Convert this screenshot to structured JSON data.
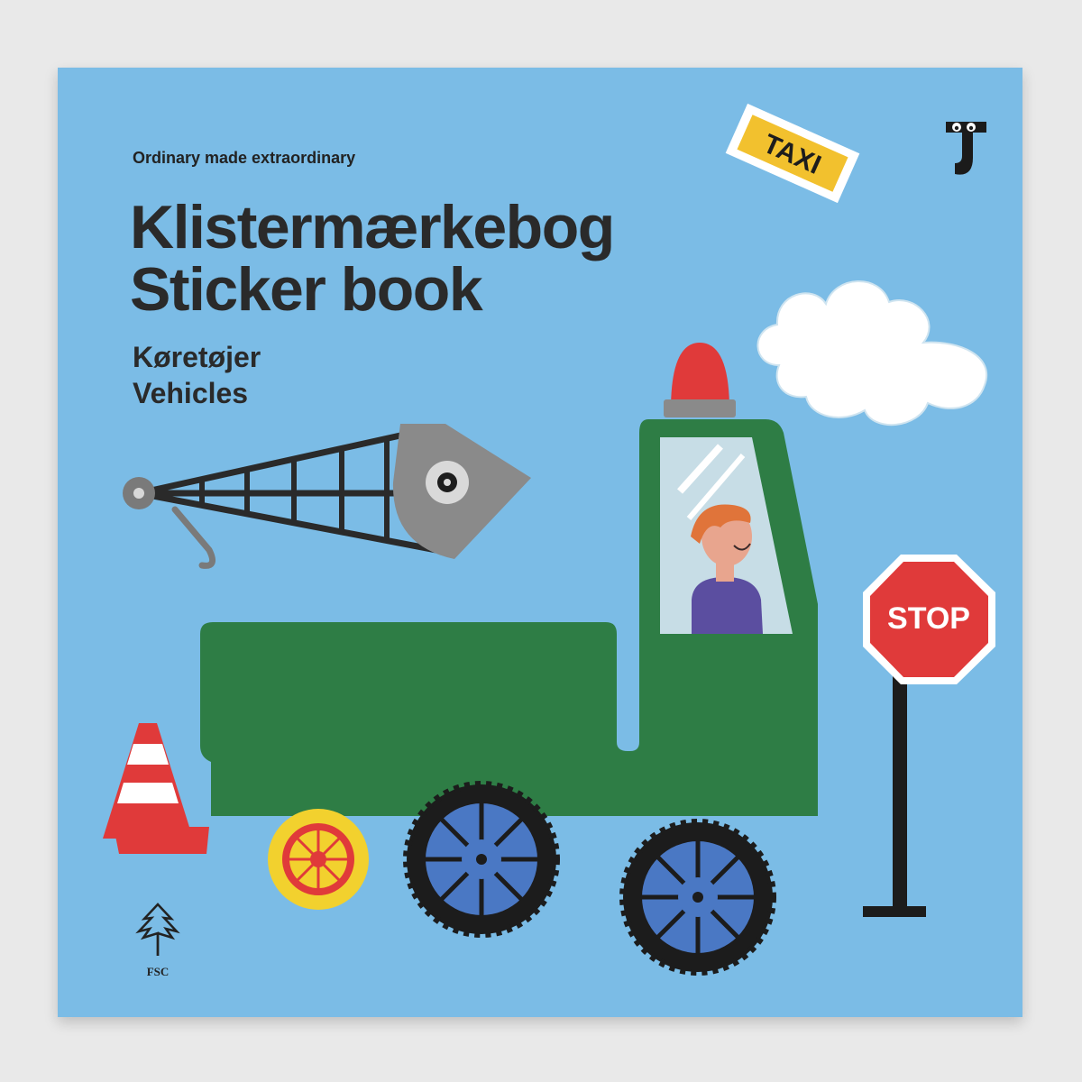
{
  "cover": {
    "tagline": "Ordinary made extraordinary",
    "title_da": "Klistermærkebog",
    "title_en": "Sticker book",
    "subtitle_da": "Køretøjer",
    "subtitle_en": "Vehicles"
  },
  "stickers": {
    "taxi_text": "TAXI",
    "stop_text": "STOP"
  },
  "certification": {
    "label": "FSC",
    "icon": "tree-icon"
  },
  "brand": {
    "logo_icon": "t-logo-icon"
  },
  "colors": {
    "background": "#e9e9e9",
    "cover_blue": "#7bbce6",
    "truck_green": "#2e7d45",
    "stop_red": "#e03a3a",
    "taxi_yellow": "#f2c12e"
  }
}
